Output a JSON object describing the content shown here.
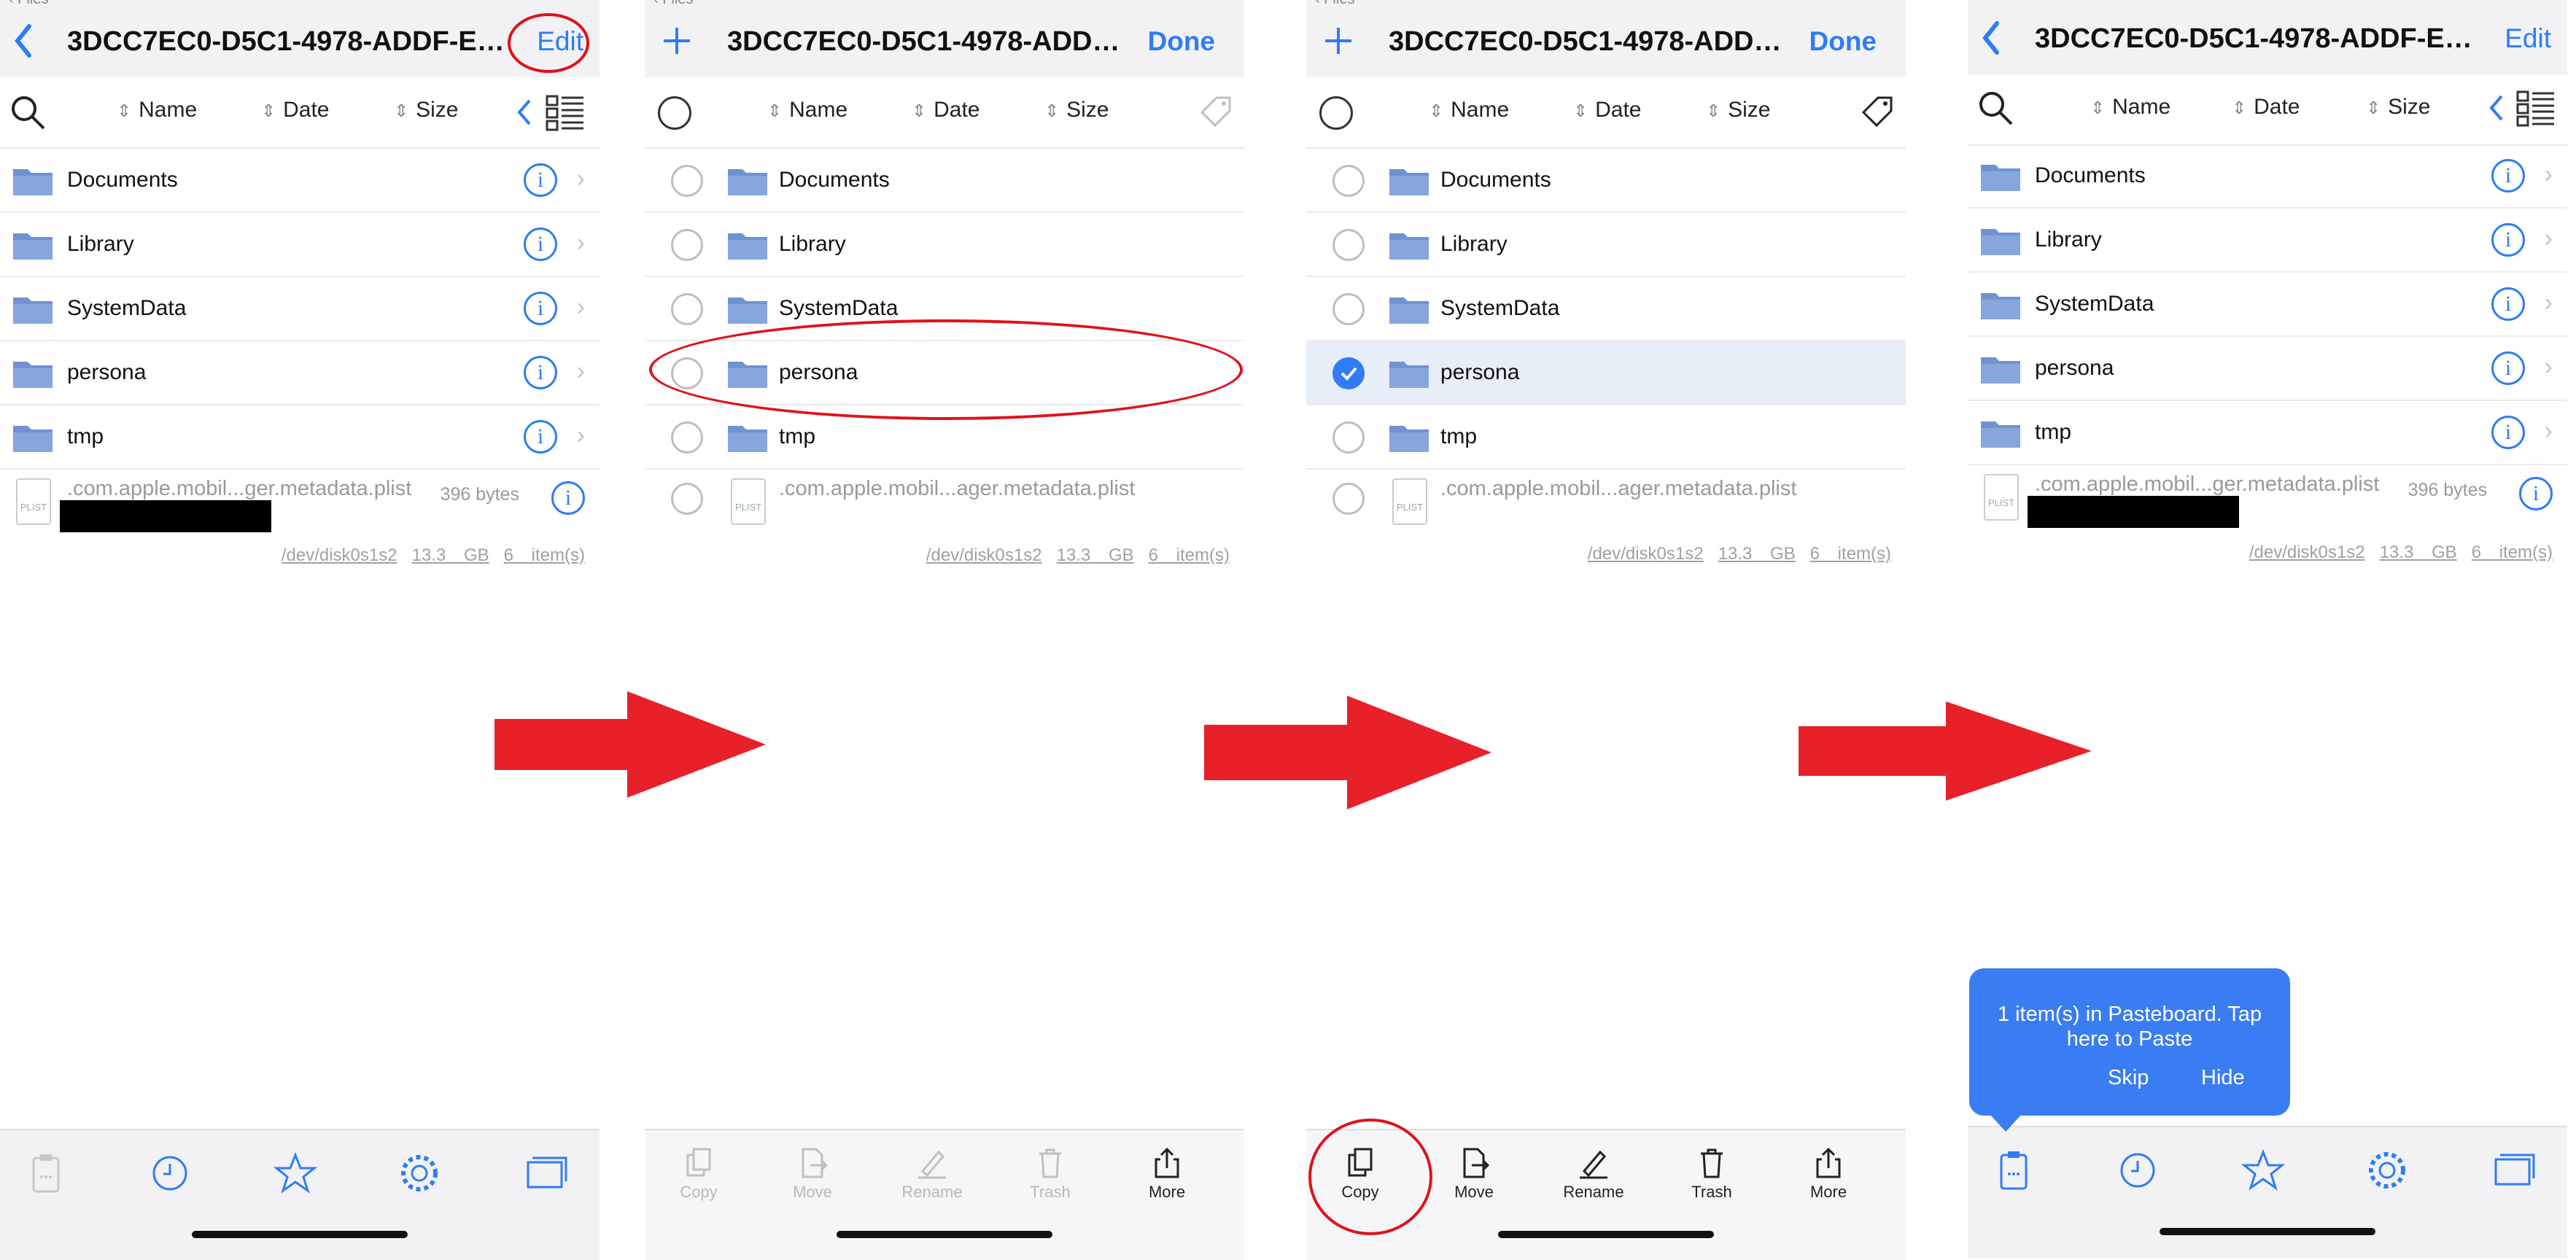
{
  "app": {
    "back_label": "‹ Files",
    "title": "3DCC7EC0-D5C1-4978-ADDF-EB17...",
    "title_edit_mode": "3DCC7EC0-D5C1-4978-ADDF-EB...",
    "edit_label": "Edit",
    "done_label": "Done"
  },
  "sort": {
    "name": "Name",
    "date": "Date",
    "size": "Size"
  },
  "folders": [
    "Documents",
    "Library",
    "SystemData",
    "persona",
    "tmp"
  ],
  "plist": {
    "name": ".com.apple.mobil...ger.metadata.plist",
    "name_edit": ".com.apple.mobil...ager.metadata.plist",
    "size": "396 bytes",
    "icon_label": "PLIST"
  },
  "volume": {
    "device": "/dev/disk0s1s2",
    "capacity": "13.3 GB",
    "items": "6 item(s)"
  },
  "actions": [
    "Copy",
    "Move",
    "Rename",
    "Trash",
    "More"
  ],
  "selected_item": "persona",
  "toast": {
    "message": "1 item(s) in Pasteboard. Tap here to Paste",
    "skip": "Skip",
    "hide": "Hide"
  },
  "icons": {
    "back": "chevron-left-icon",
    "add": "plus-icon",
    "search": "search-icon",
    "folder": "folder-icon",
    "info": "info-icon",
    "chevron": "chevron-right-icon",
    "grid": "list-view-icon",
    "tag": "tag-icon",
    "tabs": [
      "clipboard-icon",
      "clock-icon",
      "star-icon",
      "gear-icon",
      "windows-icon"
    ]
  },
  "colors": {
    "accent": "#2f7cf6",
    "folder": "#6f93d0",
    "arrow": "#e8202a",
    "highlight": "#e0121b",
    "toast": "#3a7df2"
  }
}
